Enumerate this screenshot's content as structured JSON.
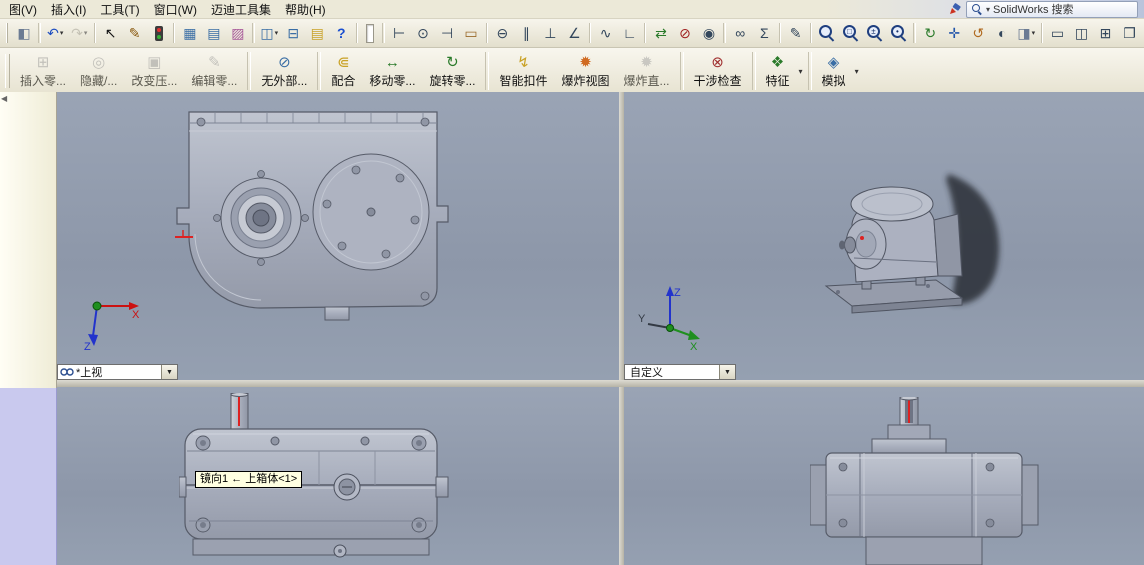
{
  "menu": {
    "items": [
      {
        "label": "图(V)"
      },
      {
        "label": "插入(I)"
      },
      {
        "label": "工具(T)"
      },
      {
        "label": "窗口(W)"
      },
      {
        "label": "迈迪工具集"
      },
      {
        "label": "帮助(H)"
      }
    ]
  },
  "search": {
    "text": "SolidWorks 搜索"
  },
  "toolbar_standard": {
    "groups": [
      {
        "icons": [
          {
            "name": "appearance-swatch-icon",
            "glyph": "◧",
            "color": "#6b7b93"
          }
        ]
      },
      {
        "icons": [
          {
            "name": "undo-icon",
            "glyph": "↶",
            "color": "#1f4fc0",
            "dropdown": true
          },
          {
            "name": "redo-icon",
            "glyph": "↷",
            "color": "#a5a295",
            "dropdown": true,
            "disabled": true
          }
        ]
      },
      {
        "icons": [
          {
            "name": "select-cursor-icon",
            "glyph": "↖",
            "color": "#141414"
          },
          {
            "name": "annotation-pen-icon",
            "glyph": "✎",
            "color": "#8a5a10"
          },
          {
            "name": "stoplight-icon",
            "type": "dots"
          }
        ]
      },
      {
        "icons": [
          {
            "name": "design-table-icon",
            "glyph": "▦",
            "color": "#3a6ea5"
          },
          {
            "name": "insert-table-icon",
            "glyph": "▤",
            "color": "#3a6ea5"
          },
          {
            "name": "palette-icon",
            "glyph": "▨",
            "color": "#a85a9a"
          }
        ]
      },
      {
        "icons": [
          {
            "name": "split-pane-icon",
            "glyph": "◫",
            "color": "#3a6ea5",
            "dropdown": true
          },
          {
            "name": "task-pane-icon",
            "glyph": "⊟",
            "color": "#3a6ea5"
          },
          {
            "name": "note-icon",
            "glyph": "▤",
            "color": "#c9a227"
          },
          {
            "name": "help-icon",
            "glyph": "?",
            "color": "#1a4fd0",
            "bold": true
          }
        ]
      },
      {
        "box": true
      },
      {
        "icons": [
          {
            "name": "dim-horizontal-icon",
            "glyph": "⊢",
            "color": "#33475c"
          },
          {
            "name": "smart-dimension-icon",
            "glyph": "⊙",
            "color": "#33475c"
          },
          {
            "name": "dim-vertical-icon",
            "glyph": "⊣",
            "color": "#33475c"
          },
          {
            "name": "ruler-icon",
            "glyph": "▭",
            "color": "#9a6a2a"
          }
        ]
      },
      {
        "icons": [
          {
            "name": "section-icon",
            "glyph": "⊖",
            "color": "#33475c"
          },
          {
            "name": "parallel-icon",
            "glyph": "∥",
            "color": "#33475c"
          },
          {
            "name": "perpendicular-icon",
            "glyph": "⊥",
            "color": "#33475c"
          },
          {
            "name": "angle-dim-icon",
            "glyph": "∠",
            "color": "#33475c"
          }
        ]
      },
      {
        "icons": [
          {
            "name": "curvature-icon",
            "glyph": "∿",
            "color": "#33475c"
          },
          {
            "name": "corner-icon",
            "glyph": "∟",
            "color": "#33475c"
          }
        ]
      },
      {
        "icons": [
          {
            "name": "compare-icon",
            "glyph": "⇄",
            "color": "#2a7a2a"
          },
          {
            "name": "hide-types-icon",
            "glyph": "⊘",
            "color": "#a02020"
          },
          {
            "name": "camera-icon",
            "glyph": "◉",
            "color": "#33475c"
          }
        ]
      },
      {
        "icons": [
          {
            "name": "loop-icon",
            "glyph": "∞",
            "color": "#33475c"
          },
          {
            "name": "equations-icon",
            "glyph": "Σ",
            "color": "#33475c"
          }
        ]
      },
      {
        "icons": [
          {
            "name": "sketch-edit-icon",
            "glyph": "✎",
            "color": "#33475c"
          }
        ]
      },
      {
        "icons": [
          {
            "name": "zoom-fit-icon",
            "type": "mag",
            "sub": ""
          },
          {
            "name": "zoom-area-icon",
            "type": "mag",
            "sub": "□"
          },
          {
            "name": "zoom-in-out-icon",
            "type": "mag",
            "sub": "±"
          },
          {
            "name": "zoom-selection-icon",
            "type": "mag",
            "sub": "•"
          }
        ]
      },
      {
        "icons": [
          {
            "name": "refresh-icon",
            "glyph": "↻",
            "color": "#2a7a2a"
          },
          {
            "name": "pan-icon",
            "glyph": "✛",
            "color": "#2255aa"
          },
          {
            "name": "rotate-view-icon",
            "glyph": "↺",
            "color": "#b06a20"
          },
          {
            "name": "display-style-icon",
            "glyph": "◐",
            "color": "#33475c"
          },
          {
            "name": "view-settings-icon",
            "glyph": "◨",
            "color": "#6b7b93",
            "dropdown": true
          }
        ]
      },
      {
        "icons": [
          {
            "name": "viewport-single-icon",
            "glyph": "▭",
            "color": "#33475c"
          },
          {
            "name": "viewport-two-icon",
            "glyph": "◫",
            "color": "#33475c"
          },
          {
            "name": "viewport-four-icon",
            "glyph": "⊞",
            "color": "#33475c"
          },
          {
            "name": "link-views-icon",
            "glyph": "❐",
            "color": "#33475c"
          }
        ]
      }
    ]
  },
  "toolbar_assembly": {
    "items": [
      {
        "label": "插入零...",
        "icon": "⊞",
        "color": "#7b8aa0",
        "name": "insert-component-button",
        "disabled": true
      },
      {
        "label": "隐藏/...",
        "icon": "◎",
        "color": "#7b8aa0",
        "name": "hide-show-components-button",
        "disabled": true
      },
      {
        "label": "改变压...",
        "icon": "▣",
        "color": "#7b8aa0",
        "name": "change-suppression-button",
        "disabled": true
      },
      {
        "label": "编辑零...",
        "icon": "✎",
        "color": "#7b8aa0",
        "name": "edit-component-button",
        "disabled": true,
        "sepAfter": true
      },
      {
        "label": "无外部...",
        "icon": "⊘",
        "color": "#3a6ea5",
        "name": "no-external-references-button",
        "sepAfter": true
      },
      {
        "label": "配合",
        "icon": "⋐",
        "color": "#c9a227",
        "name": "mate-button"
      },
      {
        "label": "移动零...",
        "icon": "↔",
        "color": "#2a7a2a",
        "name": "move-component-button"
      },
      {
        "label": "旋转零...",
        "icon": "↻",
        "color": "#2a7a2a",
        "name": "rotate-component-button",
        "sepAfter": true
      },
      {
        "label": "智能扣件",
        "icon": "↯",
        "color": "#c9a227",
        "name": "smart-fasteners-button"
      },
      {
        "label": "爆炸视图",
        "icon": "✹",
        "color": "#d06a20",
        "name": "exploded-view-button"
      },
      {
        "label": "爆炸直...",
        "icon": "✹",
        "color": "#9a978b",
        "name": "explode-line-sketch-button",
        "disabled": true,
        "sepAfter": true
      },
      {
        "label": "干涉检查",
        "icon": "⊗",
        "color": "#a03030",
        "name": "interference-detection-button",
        "sepAfter": true
      },
      {
        "label": "特征",
        "icon": "❖",
        "color": "#2a7a2a",
        "name": "features-button",
        "dropdown": true,
        "sepAfter": true
      },
      {
        "label": "模拟",
        "icon": "◈",
        "color": "#3a6ea5",
        "name": "simulation-button",
        "dropdown": true
      }
    ]
  },
  "viewports": {
    "top_left": {
      "view_selector": "*上视",
      "triad_x": "X",
      "triad_z": "Z"
    },
    "top_right": {
      "view_selector": "自定义",
      "triad_x": "X",
      "triad_y": "Y",
      "triad_z": "Z"
    },
    "bottom_left": {
      "tooltip": "镜向1 ←  上箱体<1>"
    }
  },
  "colors": {
    "toolbar_bg": "#ece9d8",
    "viewport_top": "#9aa4b5",
    "viewport_bottom": "#8d97a9",
    "model_fill": "#aab0be",
    "model_stroke": "#565b68",
    "accent_red": "#cc2222",
    "panel_cream": "#fdfbe9",
    "panel_lavender": "#c9c9ee",
    "tooltip_bg": "#ffffe1"
  }
}
